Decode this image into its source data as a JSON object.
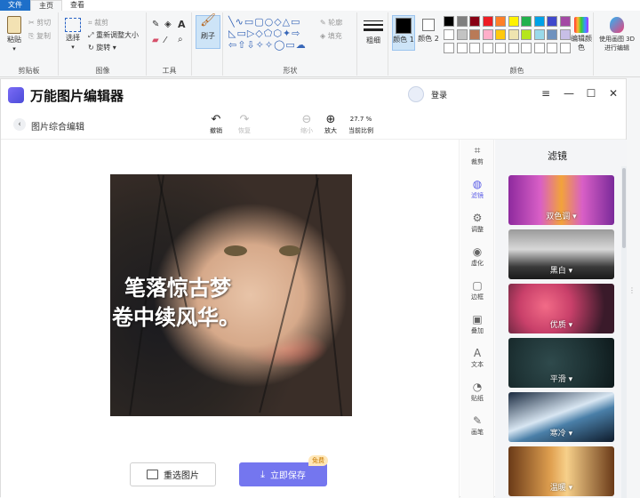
{
  "ribbon": {
    "tabs": [
      "文件",
      "主页",
      "查看"
    ],
    "clipboard": {
      "paste": "粘贴",
      "cut": "剪切",
      "copy": "复制",
      "label": "剪贴板"
    },
    "image": {
      "select": "选择",
      "crop": "裁剪",
      "resize": "重新调整大小",
      "rotate": "旋转",
      "label": "图像"
    },
    "tools": {
      "label": "工具"
    },
    "brush": {
      "label": "刷子"
    },
    "shapes": {
      "outline": "轮廓",
      "fill": "填充",
      "label": "形状"
    },
    "size": {
      "label": "粗细"
    },
    "color1": {
      "label": "颜色 1"
    },
    "color2": {
      "label": "颜色 2"
    },
    "colors": {
      "label": "颜色",
      "edit": "编辑颜色"
    },
    "paint3d": {
      "label": "使用画图 3D 进行编辑"
    },
    "palette": [
      "#000000",
      "#7f7f7f",
      "#880015",
      "#ed1c24",
      "#ff7f27",
      "#fff200",
      "#22b14c",
      "#00a2e8",
      "#3f48cc",
      "#a349a4",
      "#ffffff",
      "#c3c3c3",
      "#b97a57",
      "#ffaec9",
      "#ffc90e",
      "#efe4b0",
      "#b5e61d",
      "#99d9ea",
      "#7092be",
      "#c8bfe7",
      "#ffffff",
      "#ffffff",
      "#ffffff",
      "#ffffff",
      "#ffffff",
      "#ffffff",
      "#ffffff",
      "#ffffff",
      "#ffffff",
      "#ffffff"
    ]
  },
  "app": {
    "title": "万能图片编辑器",
    "login": "登录",
    "breadcrumb": "图片综合编辑",
    "toolbar": {
      "undo": "撤销",
      "redo": "恢复",
      "zoom_out": "缩小",
      "zoom_in": "放大",
      "zoom_value": "27.7 %",
      "zoom_label": "当前比例"
    },
    "photo_text": {
      "line1": "笔落惊古梦",
      "line2": "卷中续风华。"
    },
    "buttons": {
      "reselect": "重选图片",
      "save": "立即保存",
      "badge": "免费"
    },
    "side_tools": [
      "裁剪",
      "滤镜",
      "调整",
      "虚化",
      "边框",
      "叠加",
      "文本",
      "贴纸",
      "画笔"
    ],
    "side_active": "滤镜",
    "filter_panel": {
      "title": "滤镜",
      "filters": [
        "双色调",
        "黑白",
        "优质",
        "平滑",
        "寒冷",
        "温暖"
      ]
    },
    "colors": {
      "accent": "#7476ef",
      "active": "#5a5ce6"
    }
  }
}
